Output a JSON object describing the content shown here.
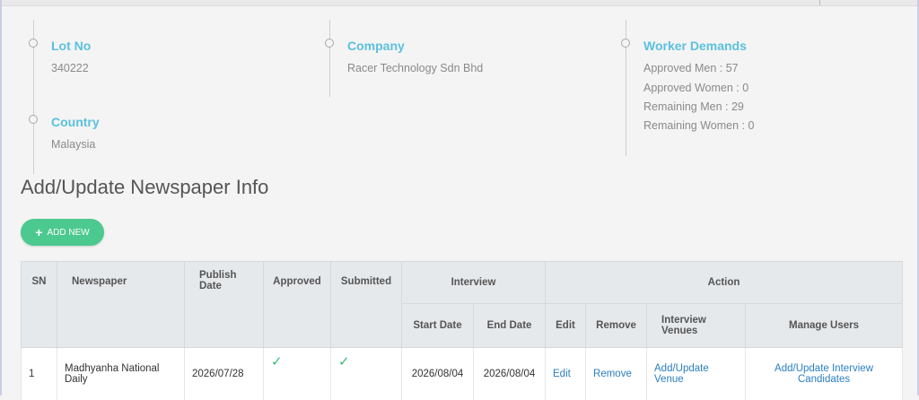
{
  "info": {
    "lot": {
      "title": "Lot No",
      "value": "340222"
    },
    "country": {
      "title": "Country",
      "value": "Malaysia"
    },
    "company": {
      "title": "Company",
      "value": "Racer Technology Sdn Bhd"
    },
    "worker_demands": {
      "title": "Worker Demands",
      "lines": [
        "Approved Men : 57",
        "Approved Women : 0",
        "Remaining Men : 29",
        "Remaining Women : 0"
      ]
    }
  },
  "page_title": "Add/Update Newspaper Info",
  "add_button": {
    "icon": "plus-icon",
    "label": "ADD NEW"
  },
  "table": {
    "headers": {
      "sn": "SN",
      "newspaper": "Newspaper",
      "publish_date": "Publish Date",
      "approved": "Approved",
      "submitted": "Submitted",
      "interview": "Interview",
      "action": "Action",
      "start_date": "Start Date",
      "end_date": "End Date",
      "edit": "Edit",
      "remove": "Remove",
      "interview_venues": "Interview Venues",
      "manage_users": "Manage Users"
    },
    "rows": [
      {
        "sn": "1",
        "newspaper": "Madhyanha National Daily",
        "publish_date": "2026/07/28",
        "approved": "✓",
        "submitted": "✓",
        "start_date": "2026/08/04",
        "end_date": "2026/08/04",
        "edit": "Edit",
        "remove": "Remove",
        "venue": "Add/Update Venue",
        "candidates": "Add/Update Interview Candidates"
      }
    ]
  },
  "colors": {
    "accent_title": "#5bc0de",
    "button": "#4cc98f",
    "link": "#2a7fc1",
    "check": "#3dbb7a"
  }
}
